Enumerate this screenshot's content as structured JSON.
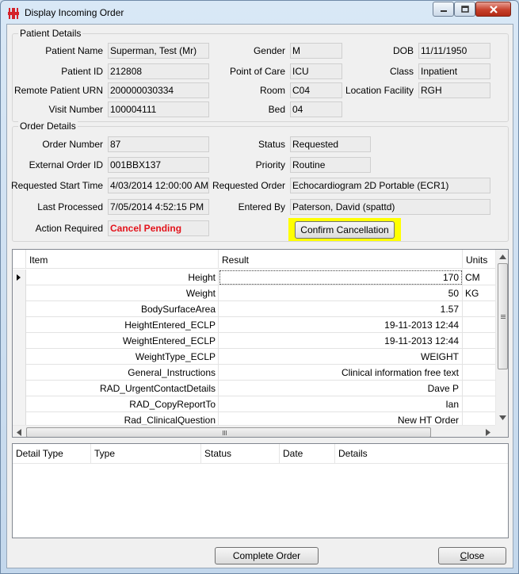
{
  "window": {
    "title": "Display Incoming Order"
  },
  "patient": {
    "legend": "Patient Details",
    "name_label": "Patient Name",
    "name": "Superman, Test (Mr)",
    "id_label": "Patient ID",
    "id": "212808",
    "urn_label": "Remote Patient URN",
    "urn": "200000030334",
    "visit_label": "Visit Number",
    "visit": "100004111",
    "gender_label": "Gender",
    "gender": "M",
    "poc_label": "Point of Care",
    "poc": "ICU",
    "room_label": "Room",
    "room": "C04",
    "bed_label": "Bed",
    "bed": "04",
    "dob_label": "DOB",
    "dob": "11/11/1950",
    "class_label": "Class",
    "class": "Inpatient",
    "facility_label": "Location Facility",
    "facility": "RGH"
  },
  "order": {
    "legend": "Order Details",
    "number_label": "Order Number",
    "number": "87",
    "ext_label": "External Order ID",
    "ext": "001BBX137",
    "start_label": "Requested Start Time",
    "start": "4/03/2014 12:00:00 AM",
    "processed_label": "Last Processed",
    "processed": "7/05/2014 4:52:15 PM",
    "action_label": "Action Required",
    "action": "Cancel Pending",
    "status_label": "Status",
    "status": "Requested",
    "priority_label": "Priority",
    "priority": "Routine",
    "requested_label": "Requested Order",
    "requested": "Echocardiogram 2D Portable (ECR1)",
    "entered_label": "Entered By",
    "entered": "Paterson, David (spattd)",
    "confirm_button": "Confirm Cancellation"
  },
  "results": {
    "headers": {
      "item": "Item",
      "result": "Result",
      "units": "Units"
    },
    "rows": [
      {
        "item": "Height",
        "result": "170",
        "units": "CM"
      },
      {
        "item": "Weight",
        "result": "50",
        "units": "KG"
      },
      {
        "item": "BodySurfaceArea",
        "result": "1.57",
        "units": ""
      },
      {
        "item": "HeightEntered_ECLP",
        "result": "19-11-2013 12:44",
        "units": ""
      },
      {
        "item": "WeightEntered_ECLP",
        "result": "19-11-2013 12:44",
        "units": ""
      },
      {
        "item": "WeightType_ECLP",
        "result": "WEIGHT",
        "units": ""
      },
      {
        "item": "General_Instructions",
        "result": "Clinical information free text",
        "units": ""
      },
      {
        "item": "RAD_UrgentContactDetails",
        "result": "Dave P",
        "units": ""
      },
      {
        "item": "RAD_CopyReportTo",
        "result": "Ian",
        "units": ""
      },
      {
        "item": "Rad_ClinicalQuestion",
        "result": "New HT Order",
        "units": ""
      }
    ]
  },
  "details": {
    "headers": {
      "detail_type": "Detail Type",
      "type": "Type",
      "status": "Status",
      "date": "Date",
      "details": "Details"
    }
  },
  "footer": {
    "complete_button": "Complete Order",
    "close_button_prefix": "",
    "close_button_accel": "C",
    "close_button_rest": "lose"
  },
  "colors": {
    "warning": "#e3131b",
    "highlight": "#ffff00"
  }
}
